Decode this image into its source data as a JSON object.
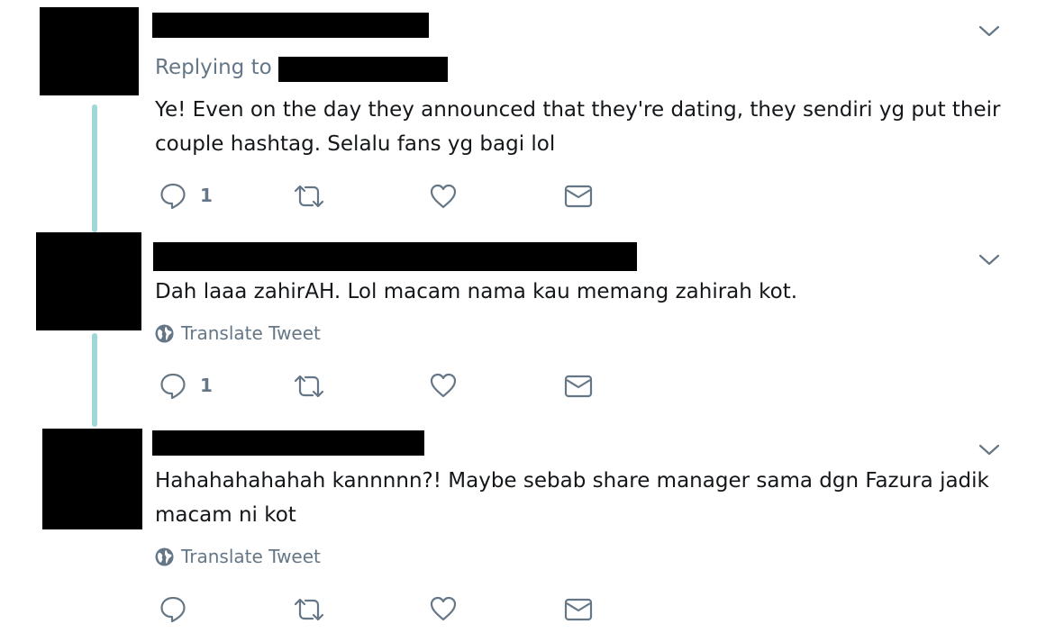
{
  "tweets": [
    {
      "replying_label": "Replying to",
      "text": "Ye! Even on the day they announced that they're dating, they sendiri yg put their couple hashtag. Selalu fans yg bagi lol",
      "reply_count": "1",
      "translate_label": ""
    },
    {
      "replying_label": "",
      "text": "Dah laaa zahirAH. Lol macam nama kau memang zahirah kot.",
      "reply_count": "1",
      "translate_label": "Translate Tweet"
    },
    {
      "replying_label": "",
      "text": "Hahahahahahah kannnnn?! Maybe sebab share manager sama dgn Fazura jadik macam ni kot",
      "reply_count": "",
      "translate_label": "Translate Tweet"
    }
  ],
  "colors": {
    "thread_line": "#9fd6d6",
    "secondary_text": "#657786",
    "primary_text": "#14171a",
    "redaction": "#000000"
  },
  "icons": {
    "reply": "speech-bubble-icon",
    "retweet": "retweet-arrows-icon",
    "like": "heart-icon",
    "dm": "envelope-icon",
    "more": "chevron-down-icon",
    "translate": "globe-icon"
  }
}
